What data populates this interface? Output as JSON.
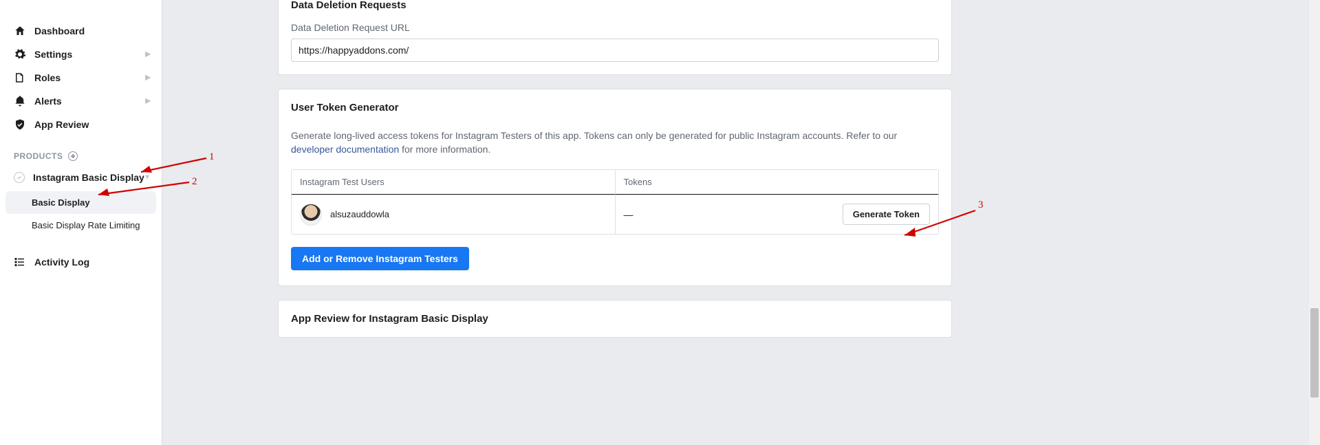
{
  "sidebar": {
    "items": [
      {
        "label": "Dashboard",
        "icon": "home-icon",
        "has_chevron": false
      },
      {
        "label": "Settings",
        "icon": "gear-icon",
        "has_chevron": true
      },
      {
        "label": "Roles",
        "icon": "roles-icon",
        "has_chevron": true
      },
      {
        "label": "Alerts",
        "icon": "bell-icon",
        "has_chevron": true
      },
      {
        "label": "App Review",
        "icon": "shield-icon",
        "has_chevron": false
      }
    ],
    "products_heading": "PRODUCTS",
    "product": {
      "label": "Instagram Basic Display"
    },
    "sub_items": [
      {
        "label": "Basic Display",
        "active": true
      },
      {
        "label": "Basic Display Rate Limiting",
        "active": false
      }
    ],
    "activity_log": "Activity Log"
  },
  "data_deletion": {
    "title": "Data Deletion Requests",
    "field_label": "Data Deletion Request URL",
    "value": "https://happyaddons.com/"
  },
  "token_gen": {
    "title": "User Token Generator",
    "desc_pre": "Generate long-lived access tokens for Instagram Testers of this app. Tokens can only be generated for public Instagram accounts. Refer to our ",
    "desc_link": "developer documentation",
    "desc_post": " for more information.",
    "col_users": "Instagram Test Users",
    "col_tokens": "Tokens",
    "user": {
      "name": "alsuzauddowla",
      "token_display": "—"
    },
    "generate_button": "Generate Token",
    "add_remove_button": "Add or Remove Instagram Testers"
  },
  "app_review": {
    "title": "App Review for Instagram Basic Display"
  },
  "annotations": {
    "n1": "1",
    "n2": "2",
    "n3": "3"
  }
}
